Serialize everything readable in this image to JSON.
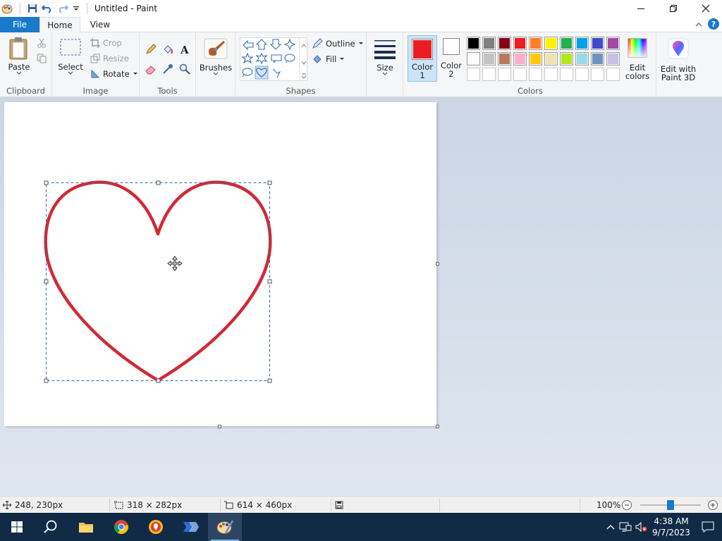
{
  "window": {
    "title": "Untitled - Paint"
  },
  "tabs": {
    "file": "File",
    "home": "Home",
    "view": "View"
  },
  "clipboard": {
    "paste": "Paste",
    "label": "Clipboard"
  },
  "image": {
    "select": "Select",
    "crop": "Crop",
    "resize": "Resize",
    "rotate": "Rotate",
    "label": "Image"
  },
  "tools": {
    "label": "Tools"
  },
  "brushes": {
    "label": "Brushes"
  },
  "shapes": {
    "outline": "Outline",
    "fill": "Fill",
    "label": "Shapes"
  },
  "size": {
    "label": "Size"
  },
  "colors": {
    "color1": "Color 1",
    "color1_line1": "Color",
    "color1_line2": "1",
    "color2_line1": "Color",
    "color2_line2": "2",
    "color1_value": "#ed1c24",
    "color2_value": "#ffffff",
    "edit_line1": "Edit",
    "edit_line2": "colors",
    "paint3d_line1": "Edit with",
    "paint3d_line2": "Paint 3D",
    "label": "Colors",
    "palette_row1": [
      "#000000",
      "#7f7f7f",
      "#880015",
      "#ed1c24",
      "#ff7f27",
      "#fff200",
      "#22b14c",
      "#00a2e8",
      "#3f48cc",
      "#a349a4"
    ],
    "palette_row2": [
      "#ffffff",
      "#c3c3c3",
      "#b97a57",
      "#ffaec9",
      "#ffc90e",
      "#efe4b0",
      "#b5e61d",
      "#99d9ea",
      "#7092be",
      "#c8bfe7"
    ]
  },
  "canvas": {
    "shape_color": "#d12a35"
  },
  "status": {
    "cursor_pos": "248, 230px",
    "selection_size": "318 × 282px",
    "image_size": "614 × 460px",
    "zoom": "100%"
  },
  "taskbar": {
    "time": "4:38 AM",
    "date": "9/7/2023"
  }
}
